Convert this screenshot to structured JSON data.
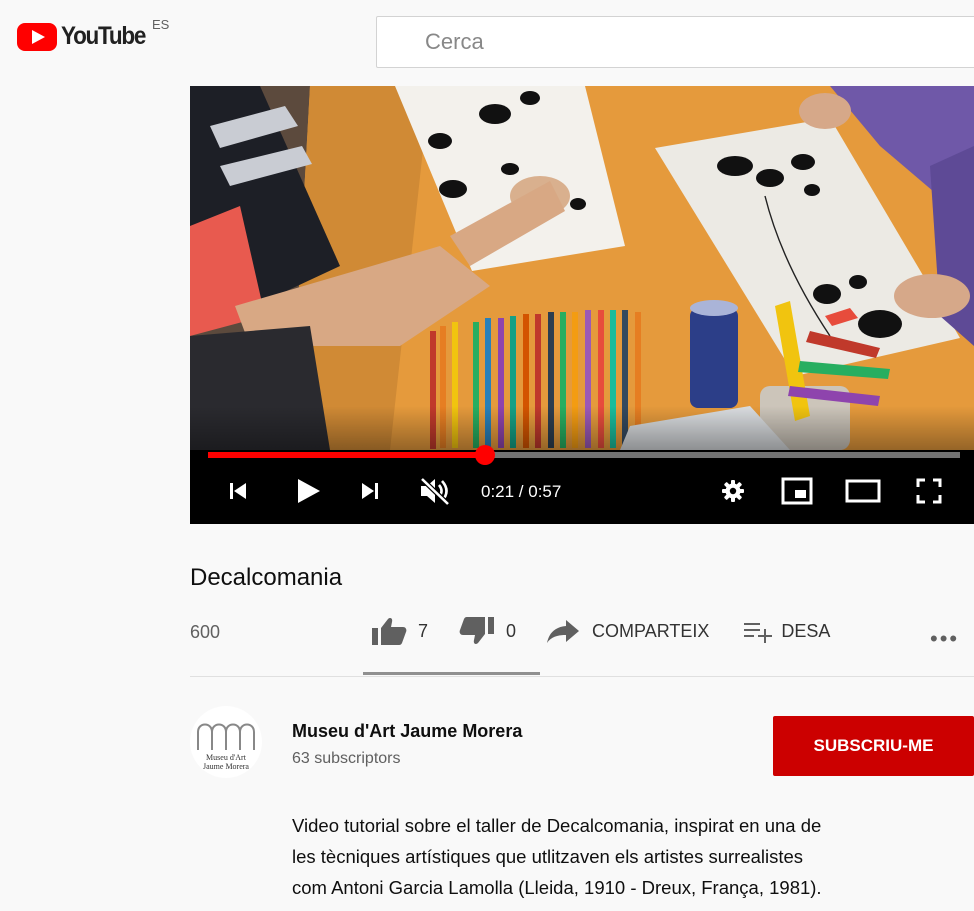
{
  "header": {
    "logo_text": "YouTube",
    "region": "ES",
    "search_placeholder": "Cerca"
  },
  "player": {
    "time_display": "0:21 / 0:57",
    "progress_fraction": 0.368,
    "icons": [
      "previous-icon",
      "play-icon",
      "next-icon",
      "muted-volume-icon",
      "settings-gear-icon",
      "miniplayer-icon",
      "theater-mode-icon",
      "fullscreen-icon"
    ]
  },
  "video": {
    "title": "Decalcomania",
    "views": "600",
    "likes": "7",
    "dislikes": "0",
    "share_label": "COMPARTEIX",
    "save_label": "DESA",
    "more_label": "•••"
  },
  "channel": {
    "name": "Museu d'Art Jaume Morera",
    "subscribers": "63 subscriptors",
    "avatar_text": "Museu d'Art\nJaume Morera",
    "subscribe_label": "SUBSCRIU-ME"
  },
  "description": {
    "lines": [
      "Video tutorial sobre el taller de Decalcomania, inspirat en una de",
      "les tècniques artístiques que utlitzaven els artistes surrealistes",
      "com Antoni Garcia Lamolla (Lleida, 1910 - Dreux, França, 1981)."
    ]
  },
  "colors": {
    "brand_red": "#ff0000",
    "subscribe_red": "#cc0000",
    "table_orange": "#e59a3c"
  }
}
